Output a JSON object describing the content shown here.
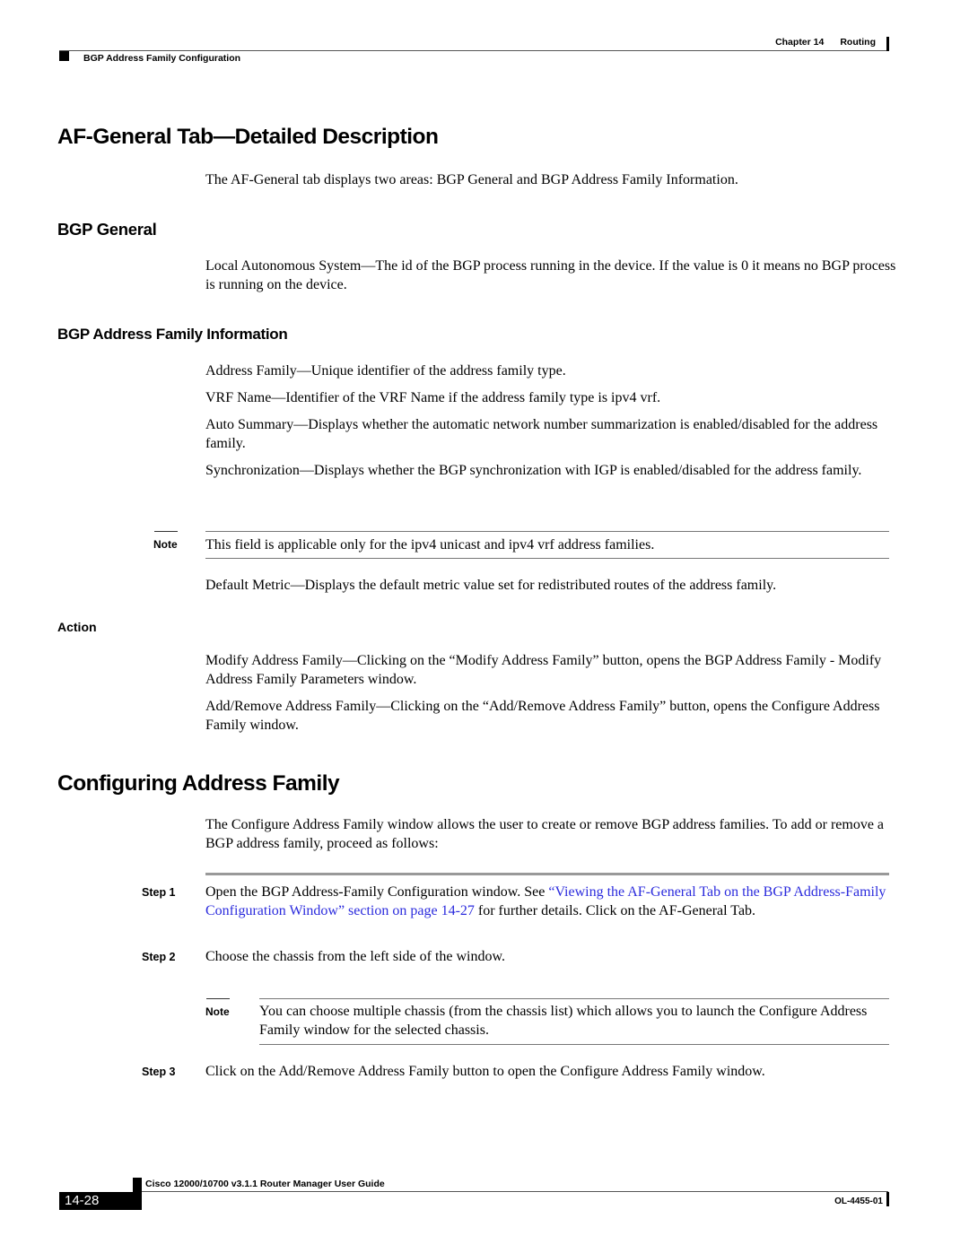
{
  "header": {
    "chapter_label": "Chapter 14",
    "chapter_title": "Routing",
    "section_title": "BGP Address Family Configuration"
  },
  "af_general": {
    "title": "AF-General Tab—Detailed Description",
    "intro": "The AF-General tab displays two areas: BGP General and BGP Address Family Information.",
    "bgp_general": {
      "title": "BGP General",
      "text": "Local Autonomous System—The id of the BGP process running in the device. If the value is 0 it means no BGP process is running on the device."
    },
    "bgp_af_info": {
      "title": "BGP Address Family Information",
      "items": [
        "Address Family—Unique identifier of the address family type.",
        "VRF Name—Identifier of the VRF Name if the address family type is ipv4 vrf.",
        "Auto Summary—Displays whether the automatic network number summarization is enabled/disabled for the address family.",
        "Synchronization—Displays whether the BGP synchronization with IGP is enabled/disabled for the address family."
      ],
      "note_label": "Note",
      "note_text": "This field is applicable only for the ipv4 unicast and ipv4 vrf address families.",
      "default_metric": "Default Metric—Displays the default metric value set for redistributed routes of the address family."
    },
    "action": {
      "title": "Action",
      "items": [
        "Modify Address Family—Clicking on the “Modify Address Family” button, opens the BGP Address Family - Modify Address Family Parameters window.",
        "Add/Remove Address Family—Clicking on the “Add/Remove Address Family” button, opens the Configure Address Family window."
      ]
    }
  },
  "configuring": {
    "title": "Configuring Address Family",
    "intro": "The Configure Address Family window allows the user to create or remove BGP address families. To add or remove a BGP address family, proceed as follows:",
    "steps": [
      {
        "label": "Step 1",
        "text_before": "Open the BGP Address-Family Configuration window. See ",
        "link": "“Viewing the AF-General Tab on the BGP Address-Family Configuration Window” section on page 14-27",
        "text_after": " for further details. Click on the AF-General Tab."
      },
      {
        "label": "Step 2",
        "text": "Choose the chassis from the left side of the window.",
        "note_label": "Note",
        "note_text": "You can choose multiple chassis (from the chassis list) which allows you to launch the Configure Address Family window for the selected chassis."
      },
      {
        "label": "Step 3",
        "text": "Click on the Add/Remove Address Family button to open the Configure Address Family window."
      }
    ]
  },
  "footer": {
    "guide_title": "Cisco 12000/10700 v3.1.1 Router Manager User Guide",
    "page_number": "14-28",
    "doc_code": "OL-4455-01"
  }
}
